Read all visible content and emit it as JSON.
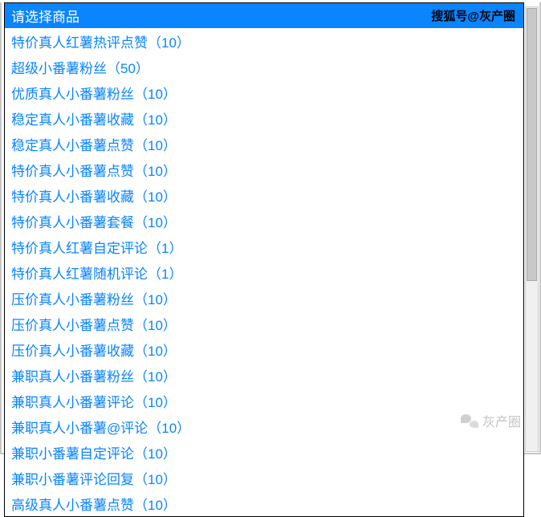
{
  "header": {
    "title": "请选择商品",
    "watermark_top": "搜狐号@灰产圈"
  },
  "options": [
    "特价真人红薯热评点赞（10）",
    "超级小番薯粉丝（50）",
    "优质真人小番薯粉丝（10）",
    "稳定真人小番薯收藏（10）",
    "稳定真人小番薯点赞（10）",
    "特价真人小番薯点赞（10）",
    "特价真人小番薯收藏（10）",
    "特价真人小番薯套餐（10）",
    "特价真人红薯自定评论（1）",
    "特价真人红薯随机评论（1）",
    "压价真人小番薯粉丝（10）",
    "压价真人小番薯点赞（10）",
    "压价真人小番薯收藏（10）",
    "兼职真人小番薯粉丝（10）",
    "兼职真人小番薯评论（10）",
    "兼职真人小番薯@评论（10）",
    "兼职小番薯自定评论（10）",
    "兼职小番薯评论回复（10）",
    "高级真人小番薯点赞（10）"
  ],
  "watermark_bottom": "灰产圈"
}
